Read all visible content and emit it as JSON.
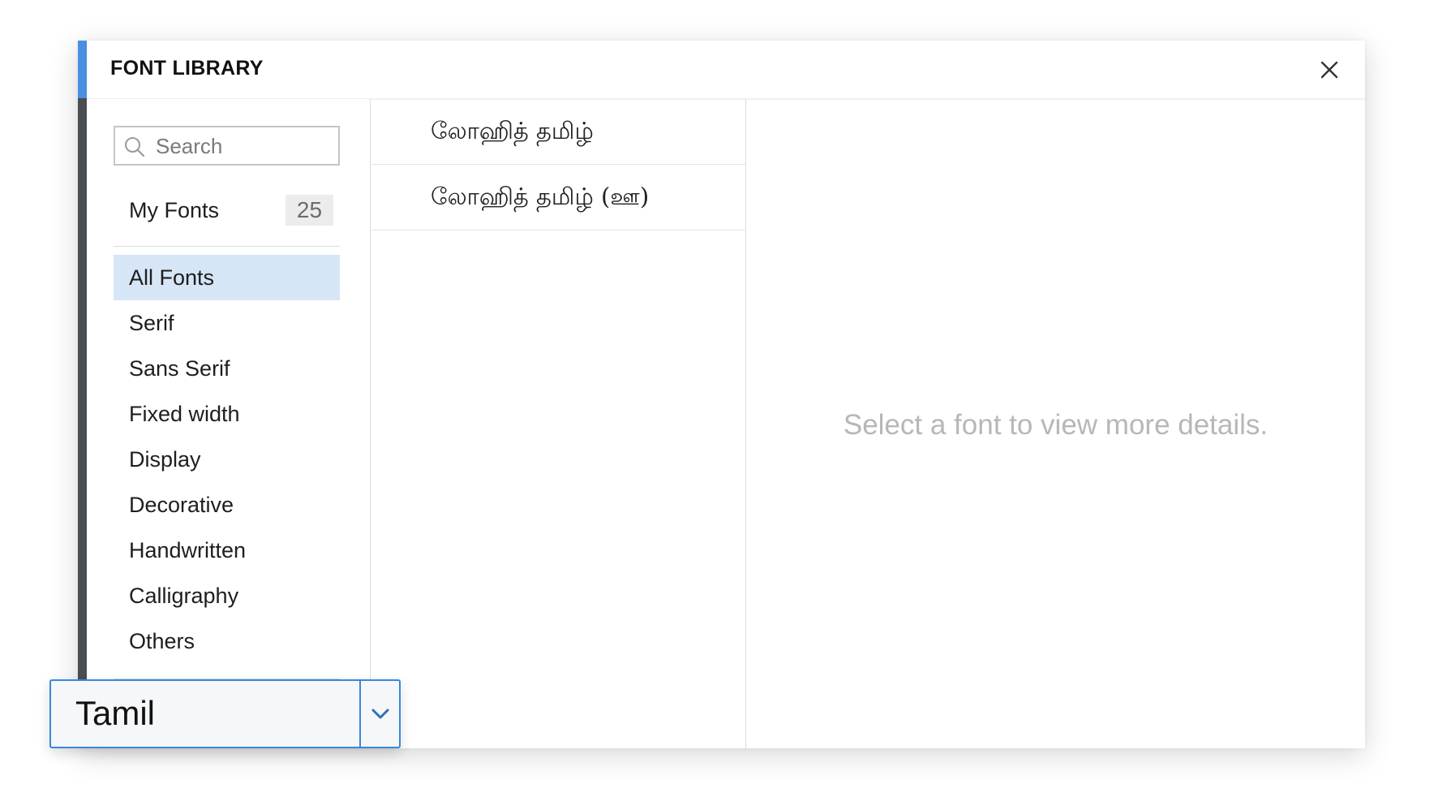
{
  "dialog": {
    "title": "FONT LIBRARY",
    "close_icon": "close-icon",
    "accent_color": "#4a90e2"
  },
  "sidebar": {
    "search": {
      "placeholder": "Search",
      "value": "",
      "icon": "search-icon"
    },
    "my_fonts": {
      "label": "My Fonts",
      "count": "25"
    },
    "categories": [
      {
        "label": "All Fonts",
        "active": true
      },
      {
        "label": "Serif",
        "active": false
      },
      {
        "label": "Sans Serif",
        "active": false
      },
      {
        "label": "Fixed width",
        "active": false
      },
      {
        "label": "Display",
        "active": false
      },
      {
        "label": "Decorative",
        "active": false
      },
      {
        "label": "Handwritten",
        "active": false
      },
      {
        "label": "Calligraphy",
        "active": false
      },
      {
        "label": "Others",
        "active": false
      }
    ],
    "active_color": "#d6e6f7"
  },
  "font_list": [
    {
      "name": "லோஹித் தமிழ்"
    },
    {
      "name": "லோஹித் தமிழ் (ஊ)"
    }
  ],
  "details": {
    "placeholder": "Select a font to view more details."
  },
  "language_select": {
    "value": "Tamil",
    "icon": "chevron-down-icon",
    "border_color": "#3a87dd"
  }
}
